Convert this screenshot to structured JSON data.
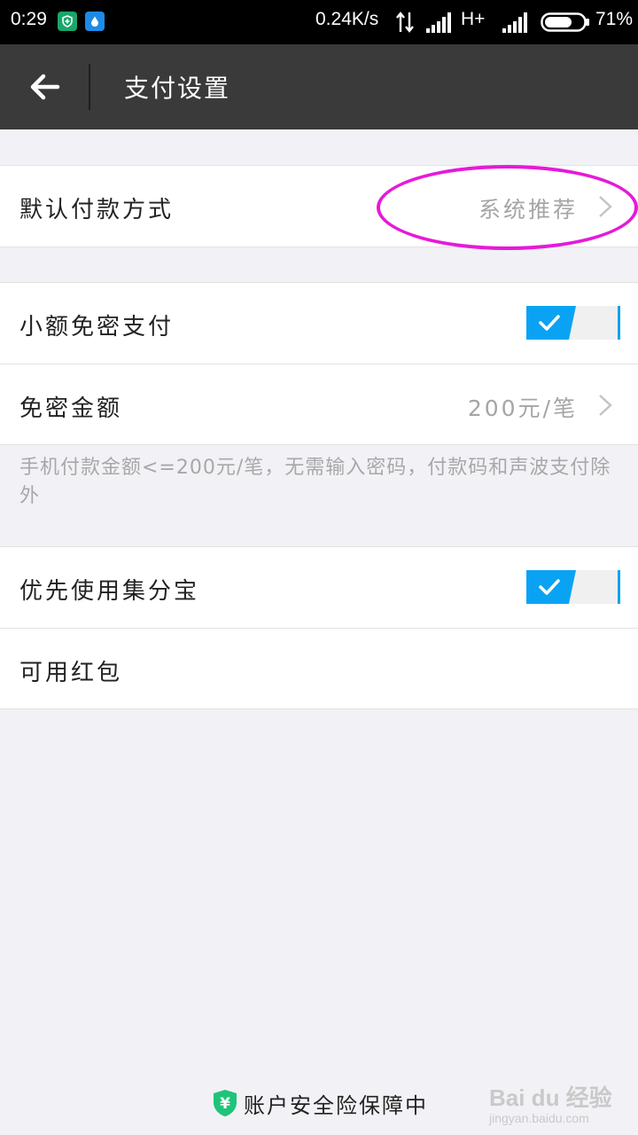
{
  "status_bar": {
    "time": "0:29",
    "net_speed": "0.24K/s",
    "network_type": "H+",
    "battery_pct": "71%",
    "battery_level": 0.71
  },
  "header": {
    "title": "支付设置"
  },
  "settings": {
    "default_payment": {
      "label": "默认付款方式",
      "value": "系统推荐"
    },
    "small_amount_free": {
      "label": "小额免密支付",
      "enabled": true
    },
    "free_amount": {
      "label": "免密金额",
      "value": "200元/笔"
    },
    "note": "手机付款金额<=200元/笔，无需输入密码，付款码和声波支付除外",
    "prefer_jifenbao": {
      "label": "优先使用集分宝",
      "enabled": true
    },
    "red_packet": {
      "label": "可用红包"
    }
  },
  "footer": {
    "security_text": "账户安全险保障中",
    "icon_symbol": "¥"
  },
  "watermark": {
    "main": "Bai du 经验",
    "sub": "jingyan.baidu.com"
  },
  "colors": {
    "header_bg": "#3a3a3a",
    "toggle_on": "#0aa3f3",
    "highlight": "#e61ad9",
    "shield_green": "#1fc37a"
  }
}
